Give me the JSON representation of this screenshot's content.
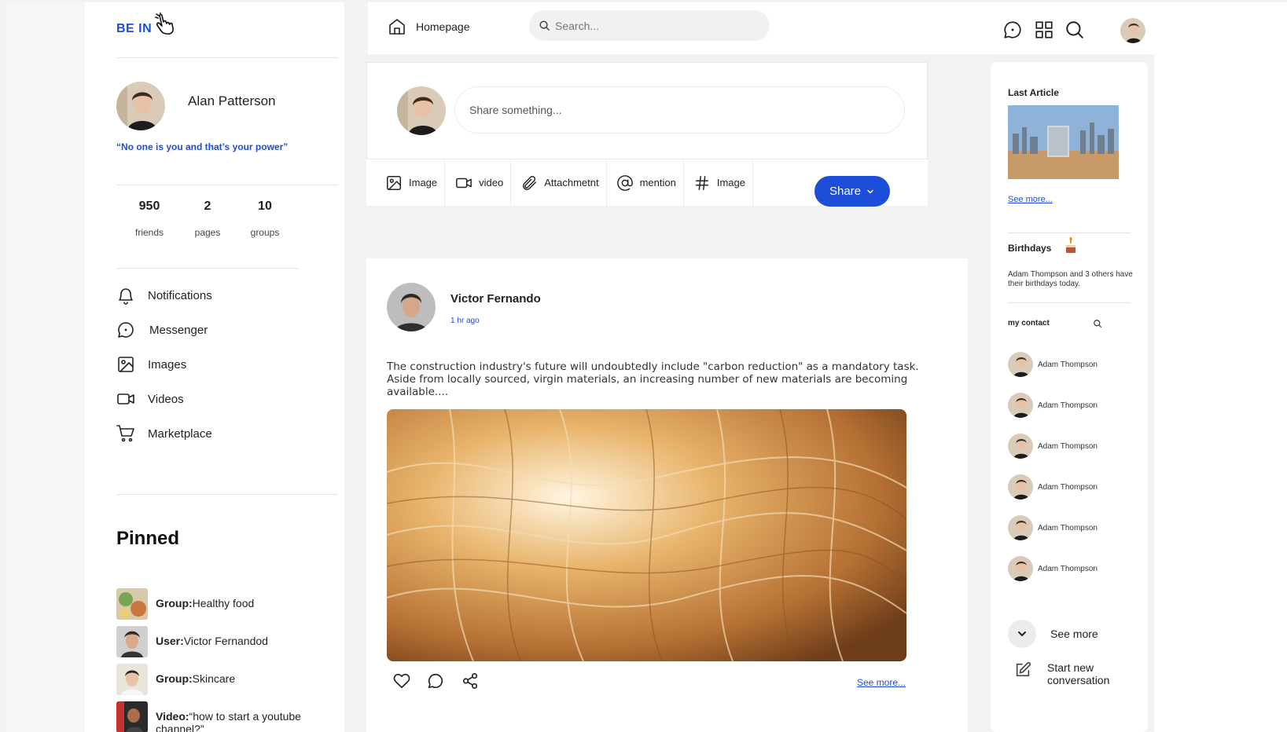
{
  "brand": {
    "logo_text": "BE IN",
    "accent": "#1d4ed8"
  },
  "profile": {
    "name": "Alan Patterson",
    "quote": "“No one is you and that’s your power”",
    "stats": [
      {
        "value": "950",
        "label": "friends"
      },
      {
        "value": "2",
        "label": "pages"
      },
      {
        "value": "10",
        "label": "groups"
      }
    ]
  },
  "sidebar": {
    "items": [
      {
        "label": "Notifications",
        "icon": "bell-icon"
      },
      {
        "label": "Messenger",
        "icon": "chat-icon"
      },
      {
        "label": "Images",
        "icon": "image-icon"
      },
      {
        "label": "Videos",
        "icon": "video-icon"
      },
      {
        "label": "Marketplace",
        "icon": "cart-icon"
      }
    ]
  },
  "pinned": {
    "title": "Pinned",
    "items": [
      {
        "kind": "Group:",
        "text": "Healthy food"
      },
      {
        "kind": "User:",
        "text": "Victor Fernandod"
      },
      {
        "kind": "Group:",
        "text": "Skincare"
      },
      {
        "kind": "Video:",
        "text": "“how to start a youtube channel?”"
      }
    ]
  },
  "header": {
    "home_label": "Homepage",
    "search_placeholder": "Search...",
    "icons": [
      "chat-icon",
      "grid-icon",
      "search-icon"
    ]
  },
  "composer": {
    "placeholder": "Share something...",
    "tools": [
      {
        "label": "Image",
        "icon": "image-icon"
      },
      {
        "label": "video",
        "icon": "video-icon"
      },
      {
        "label": "Attachmetnt",
        "icon": "paperclip-icon"
      },
      {
        "label": "mention",
        "icon": "at-icon"
      },
      {
        "label": "Image",
        "icon": "hashtag-icon"
      }
    ],
    "share_label": "Share"
  },
  "post": {
    "author": "Victor Fernando",
    "time": "1 hr ago",
    "text": "The construction industry's future will undoubtedly include \"carbon reduction\" as a mandatory task. Aside from locally sourced, virgin materials, an increasing number of new materials are becoming available....",
    "see_more": "See more..."
  },
  "right": {
    "last_article_title": "Last Article",
    "article_see_more": "See more...",
    "birthdays_title": "Birthdays",
    "birthdays_text": "Adam Thompson and 3 others have their birthdays today.",
    "contacts_title": "my contact",
    "contacts": [
      "Adam Thompson",
      "Adam Thompson",
      "Adam Thompson",
      "Adam Thompson",
      "Adam Thompson",
      "Adam Thompson"
    ],
    "see_more": "See more",
    "new_conversation": "Start new conversation"
  }
}
